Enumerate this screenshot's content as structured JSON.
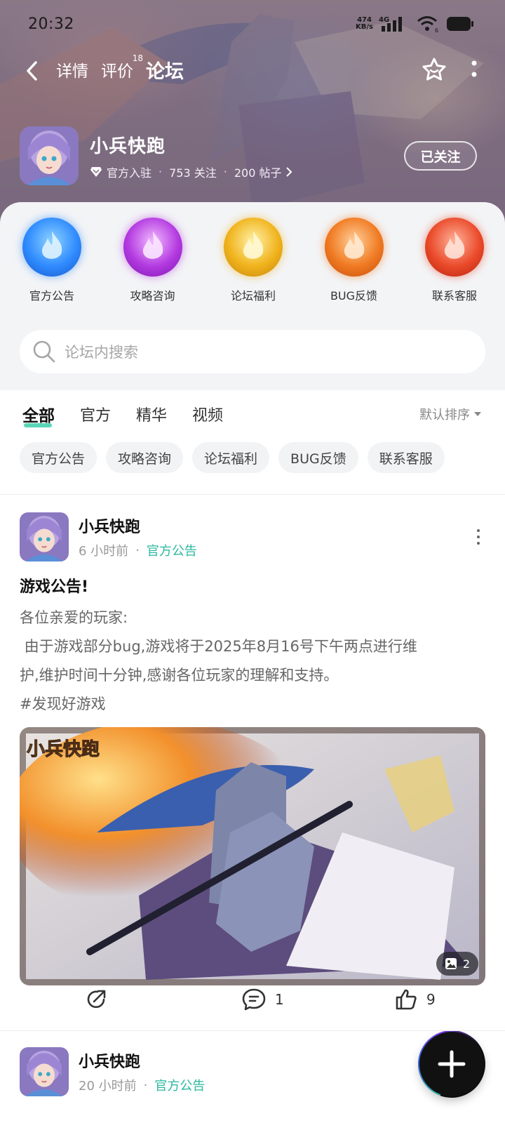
{
  "status_bar": {
    "time": "20:32",
    "net_speed_value": "474",
    "net_speed_unit": "KB/s",
    "signal_label": "4G",
    "wifi_badge": "6"
  },
  "nav": {
    "tabs": [
      {
        "label": "详情"
      },
      {
        "label": "评价",
        "badge": "18"
      },
      {
        "label": "论坛"
      }
    ]
  },
  "profile": {
    "name": "小兵快跑",
    "official_label": "官方入驻",
    "followers": "753 关注",
    "posts": "200 帖子",
    "follow_button": "已关注"
  },
  "categories": [
    {
      "label": "官方公告",
      "color": "#2f8bff"
    },
    {
      "label": "攻略咨询",
      "color": "#b33ae0"
    },
    {
      "label": "论坛福利",
      "color": "#f0b31c"
    },
    {
      "label": "BUG反馈",
      "color": "#f07a22"
    },
    {
      "label": "联系客服",
      "color": "#ea4a2a"
    }
  ],
  "search": {
    "placeholder": "论坛内搜索"
  },
  "filter_tabs": [
    "全部",
    "官方",
    "精华",
    "视频"
  ],
  "sort_label": "默认排序",
  "chips": [
    "官方公告",
    "攻略咨询",
    "论坛福利",
    "BUG反馈",
    "联系客服"
  ],
  "posts": [
    {
      "author": "小兵快跑",
      "time": "6 小时前",
      "tag": "官方公告",
      "title": "游戏公告!",
      "body_lines": [
        "各位亲爱的玩家:",
        " 由于游戏部分bug,游戏将于2025年8月16号下午两点进行维",
        "护,维护时间十分钟,感谢各位玩家的理解和支持。"
      ],
      "hashtag": "#发现好游戏",
      "image_count": "2",
      "comments": "1",
      "likes": "9",
      "image_logo_text": "小兵快跑"
    },
    {
      "author": "小兵快跑",
      "time": "20 小时前",
      "tag": "官方公告"
    }
  ],
  "accent_color": "#59d6b8",
  "tag_color": "#2bb8a0"
}
